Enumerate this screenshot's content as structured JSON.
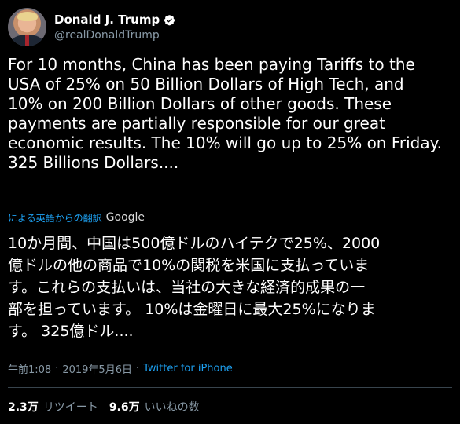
{
  "author": {
    "name": "Donald J. Trump",
    "handle": "@realDonaldTrump",
    "verified_icon": "verified-badge-icon"
  },
  "tweet": {
    "text": "For 10 months, China has been paying Tariffs to the\nUSA of 25% on 50 Billion Dollars of High Tech, and\n10% on 200 Billion Dollars of other goods. These\npayments are partially responsible for our great\neconomic results. The 10% will go up to 25% on Friday.\n325 Billions Dollars....",
    "translate_label": "による英語からの翻訳",
    "translate_provider": "Google",
    "translated_text": "10か月間、中国は500億ドルのハイテクで25%、2000\n億ドルの他の商品で10%の関税を米国に支払っていま\nす。これらの支払いは、当社の大きな経済的成果の一\n部を担っています。 10%は金曜日に最大25%になりま\nす。 325億ドル....",
    "time": "午前1:08",
    "separator": "·",
    "date": "2019年5月6日",
    "source": "Twitter for iPhone"
  },
  "stats": {
    "retweets_count": "2.3万",
    "retweets_label": "リツイート",
    "likes_count": "9.6万",
    "likes_label": "いいねの数"
  },
  "colors": {
    "background": "#000000",
    "text": "#ffffff",
    "secondary": "#8899a6",
    "link": "#1da1f2",
    "divider": "#38444d"
  }
}
